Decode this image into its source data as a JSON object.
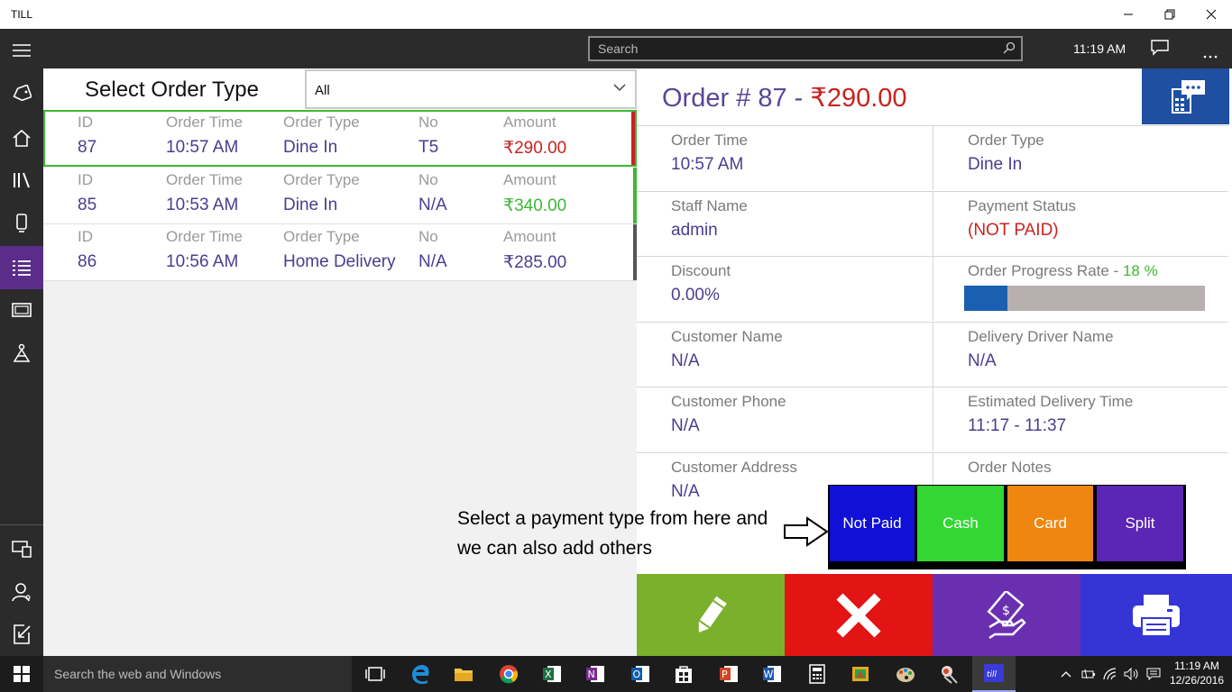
{
  "window": {
    "title": "TILL"
  },
  "appbar": {
    "search_placeholder": "Search",
    "time": "11:19 AM"
  },
  "order_list": {
    "heading": "Select Order Type",
    "filter_value": "All",
    "headers": {
      "id": "ID",
      "time": "Order Time",
      "type": "Order Type",
      "no": "No",
      "amount": "Amount"
    },
    "orders": [
      {
        "id": "87",
        "time": "10:57 AM",
        "type": "Dine In",
        "no": "T5",
        "amount": "₹290.00",
        "amount_color": "#c8231f",
        "bar_color": "#c8231f"
      },
      {
        "id": "85",
        "time": "10:53 AM",
        "type": "Dine In",
        "no": "N/A",
        "amount": "₹340.00",
        "amount_color": "#3db834",
        "bar_color": "#3db834"
      },
      {
        "id": "86",
        "time": "10:56 AM",
        "type": "Home Delivery",
        "no": "N/A",
        "amount": "₹285.00",
        "amount_color": "#4a3d8f",
        "bar_color": "#555555"
      }
    ]
  },
  "order_detail": {
    "title": "Order # 87 - ",
    "amount": "₹290.00",
    "fields": {
      "order_time_label": "Order Time",
      "order_time": "10:57 AM",
      "order_type_label": "Order Type",
      "order_type": "Dine In",
      "staff_label": "Staff Name",
      "staff": "admin",
      "payment_status_label": "Payment Status",
      "payment_status": "(NOT PAID)",
      "discount_label": "Discount",
      "discount": "0.00%",
      "progress_label": "Order Progress Rate - ",
      "progress_pct": "18 %",
      "progress_value": 18,
      "customer_name_label": "Customer Name",
      "customer_name": "N/A",
      "driver_label": "Delivery Driver Name",
      "driver": "N/A",
      "customer_phone_label": "Customer Phone",
      "customer_phone": "N/A",
      "est_delivery_label": "Estimated Delivery Time",
      "est_delivery": "11:17  -  11:37",
      "customer_address_label": "Customer Address",
      "customer_address": "N/A",
      "notes_label": "Order Notes"
    }
  },
  "payment": {
    "hint": "Select a payment type from here and we can also add others",
    "buttons": [
      {
        "label": "Not Paid",
        "color": "#1010d6"
      },
      {
        "label": "Cash",
        "color": "#33d633"
      },
      {
        "label": "Card",
        "color": "#ef860f"
      },
      {
        "label": "Split",
        "color": "#5b25b5"
      }
    ]
  },
  "actions": {
    "edit_color": "#7bb02d",
    "cancel_color": "#e21414",
    "pay_color": "#6a2fb0",
    "print_color": "#3535d6"
  },
  "taskbar": {
    "search_placeholder": "Search the web and Windows",
    "time": "11:19 AM",
    "date": "12/26/2016"
  }
}
